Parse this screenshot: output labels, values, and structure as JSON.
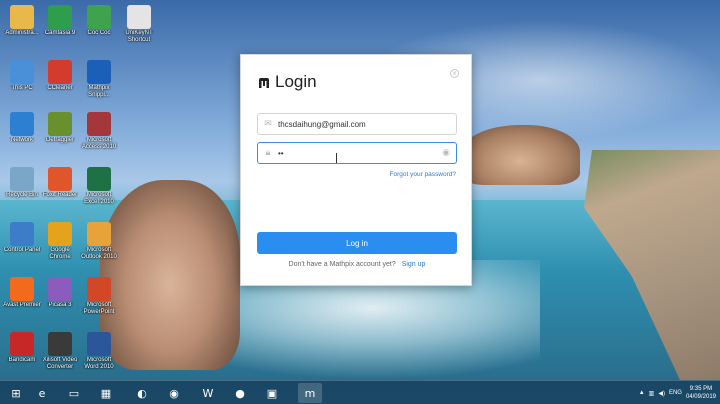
{
  "desktop": {
    "icons": [
      {
        "label": "Administra...",
        "icon": "folder-icon",
        "color": "#e8b84a"
      },
      {
        "label": "Camtasia 9",
        "icon": "camtasia-icon",
        "color": "#2e9e4e"
      },
      {
        "label": "Cốc Cốc",
        "icon": "coccoc-icon",
        "color": "#3fa34d"
      },
      {
        "label": "UniKeyNT Shortcut",
        "icon": "unikey-icon",
        "color": "#e4e4e4"
      },
      {
        "label": "This PC",
        "icon": "computer-icon",
        "color": "#4a90d9"
      },
      {
        "label": "CCleaner",
        "icon": "ccleaner-icon",
        "color": "#d33b2c"
      },
      {
        "label": "Mathpix Snippi...",
        "icon": "mathpix-icon",
        "color": "#1b5fb8"
      },
      {
        "label": "Network",
        "icon": "network-icon",
        "color": "#2d7fd1"
      },
      {
        "label": "Defraggler",
        "icon": "defraggler-icon",
        "color": "#6a8f2d"
      },
      {
        "label": "Microsoft Access 2010",
        "icon": "access-icon",
        "color": "#a4373a"
      },
      {
        "label": "Recycle Bin",
        "icon": "recycle-bin-icon",
        "color": "#7aa6c8"
      },
      {
        "label": "Foxit Reader",
        "icon": "foxit-icon",
        "color": "#e0562a"
      },
      {
        "label": "Microsoft Excel 2010",
        "icon": "excel-icon",
        "color": "#1e7145"
      },
      {
        "label": "Control Panel",
        "icon": "control-panel-icon",
        "color": "#3d7cc9"
      },
      {
        "label": "Google Chrome",
        "icon": "chrome-icon",
        "color": "#e5a21c"
      },
      {
        "label": "Microsoft Outlook 2010",
        "icon": "outlook-icon",
        "color": "#e8a23a"
      },
      {
        "label": "Avast Premier",
        "icon": "avast-icon",
        "color": "#f26b1d"
      },
      {
        "label": "Picasa 3",
        "icon": "picasa-icon",
        "color": "#8b5bbd"
      },
      {
        "label": "Microsoft PowerPoint",
        "icon": "powerpoint-icon",
        "color": "#d24726"
      },
      {
        "label": "Bandicam",
        "icon": "bandicam-icon",
        "color": "#c62828"
      },
      {
        "label": "Xilisoft Video Converter",
        "icon": "xilisoft-icon",
        "color": "#3a3a3a"
      },
      {
        "label": "Microsoft Word 2010",
        "icon": "word-icon",
        "color": "#2b579a"
      }
    ]
  },
  "dialog": {
    "title": "Login",
    "close_label": "×",
    "email_value": "thcsdaihung@gmail.com",
    "password_value": "••",
    "forgot_label": "Forgot your password?",
    "login_button": "Log in",
    "signup_prompt": "Don't have a Mathpix account yet?",
    "signup_link": "Sign up",
    "accent_color": "#2a8ef0"
  },
  "taskbar": {
    "items": [
      {
        "icon": "windows-start-icon",
        "glyph": "⊞"
      },
      {
        "icon": "internet-explorer-icon",
        "glyph": "e"
      },
      {
        "icon": "file-explorer-icon",
        "glyph": "▭"
      },
      {
        "icon": "store-icon",
        "glyph": "▦"
      },
      {
        "icon": "coccoc-icon",
        "glyph": "◐"
      },
      {
        "icon": "chrome-icon",
        "glyph": "◉"
      },
      {
        "icon": "word-icon",
        "glyph": "W"
      },
      {
        "icon": "bandicam-icon",
        "glyph": "●"
      },
      {
        "icon": "photos-icon",
        "glyph": "▣"
      },
      {
        "icon": "mathpix-icon",
        "glyph": "m"
      }
    ],
    "language": "ENG",
    "time": "9:35 PM",
    "date": "04/09/2019"
  }
}
